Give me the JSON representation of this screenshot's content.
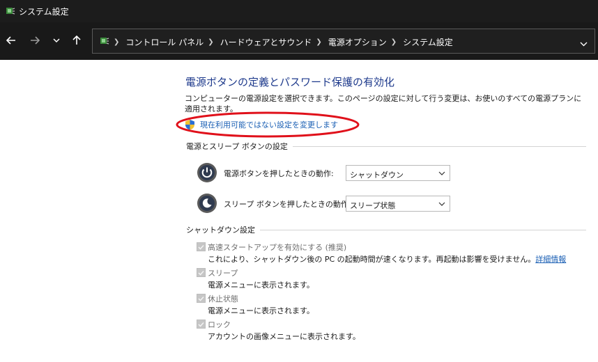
{
  "window": {
    "title": "システム設定",
    "app_icon": "power-options-icon"
  },
  "nav": {
    "buttons": [
      "back-arrow-icon",
      "forward-arrow-icon",
      "recent-dropdown-icon",
      "up-arrow-icon"
    ],
    "breadcrumbs": [
      "コントロール パネル",
      "ハードウェアとサウンド",
      "電源オプション",
      "システム設定"
    ]
  },
  "page": {
    "title": "電源ボタンの定義とパスワード保護の有効化",
    "description": "コンピューターの電源設定を選択できます。このページの設定に対して行う変更は、お使いのすべての電源プランに適用されます。",
    "admin_link": "現在利用可能ではない設定を変更します"
  },
  "power_section": {
    "header": "電源とスリープ ボタンの設定",
    "rows": [
      {
        "label": "電源ボタンを押したときの動作:",
        "value": "シャットダウン",
        "icon": "power-button-icon"
      },
      {
        "label": "スリープ ボタンを押したときの動作:",
        "value": "スリープ状態",
        "icon": "sleep-button-icon"
      }
    ]
  },
  "shutdown_section": {
    "header": "シャットダウン設定",
    "items": [
      {
        "label": "高速スタートアップを有効にする (推奨)",
        "desc": "これにより、シャットダウン後の PC の起動時間が速くなります。再起動は影響を受けません。",
        "link": "詳細情報",
        "checked": true
      },
      {
        "label": "スリープ",
        "desc": "電源メニューに表示されます。",
        "checked": true
      },
      {
        "label": "休止状態",
        "desc": "電源メニューに表示されます。",
        "checked": true
      },
      {
        "label": "ロック",
        "desc": "アカウントの画像メニューに表示されます。",
        "checked": true
      }
    ]
  },
  "colors": {
    "title_blue": "#1e3a8c",
    "link_blue": "#1a5fb4",
    "annotation_red": "#e0101a",
    "dark_chrome": "#191919"
  }
}
